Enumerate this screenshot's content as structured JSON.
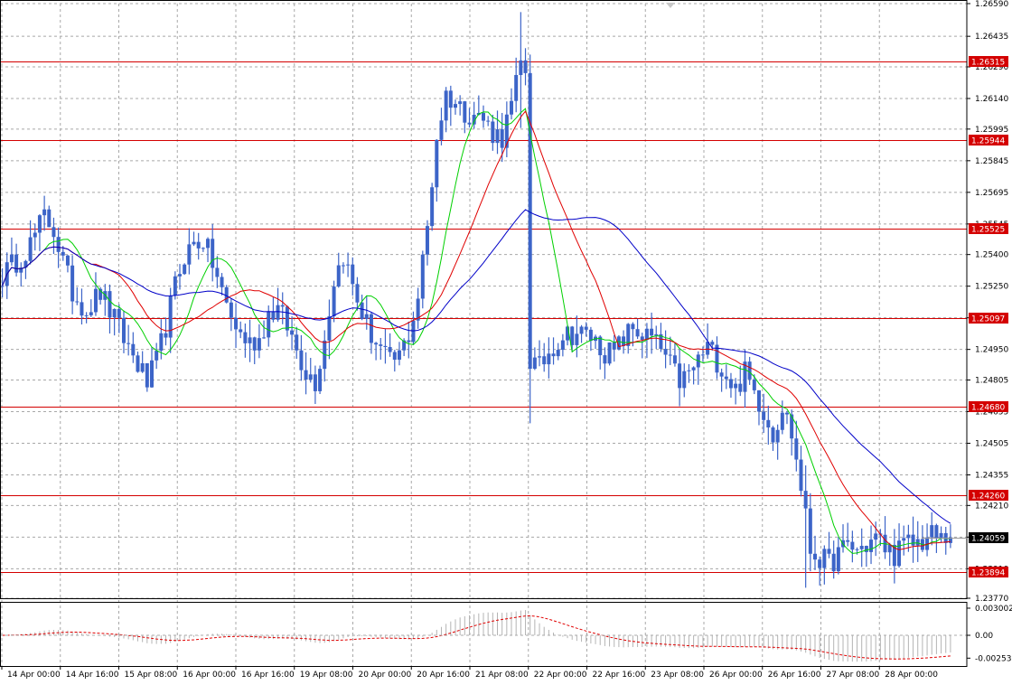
{
  "chart_data": {
    "type": "candlestick",
    "instrument_hint": "forex",
    "price_axis": {
      "min": 1.2377,
      "max": 1.2659,
      "ticks": [
        "1.26590",
        "1.26435",
        "1.26290",
        "1.26140",
        "1.25995",
        "1.25845",
        "1.25695",
        "1.25545",
        "1.25400",
        "1.25250",
        "1.25100",
        "1.24950",
        "1.24805",
        "1.24655",
        "1.24505",
        "1.24355",
        "1.24210",
        "1.24060",
        "1.23910",
        "1.23770"
      ]
    },
    "time_axis": {
      "labels": [
        "14 Apr 00:00",
        "14 Apr 16:00",
        "15 Apr 08:00",
        "16 Apr 00:00",
        "16 Apr 16:00",
        "19 Apr 08:00",
        "20 Apr 00:00",
        "20 Apr 16:00",
        "21 Apr 08:00",
        "22 Apr 00:00",
        "22 Apr 16:00",
        "23 Apr 08:00",
        "26 Apr 00:00",
        "26 Apr 16:00",
        "27 Apr 08:00",
        "28 Apr 00:00"
      ]
    },
    "horizontal_levels": [
      {
        "price": 1.26315,
        "label": "1.26315",
        "color": "#d40000"
      },
      {
        "price": 1.25944,
        "label": "1.25944",
        "color": "#d40000"
      },
      {
        "price": 1.25525,
        "label": "1.25525",
        "color": "#d40000"
      },
      {
        "price": 1.25097,
        "label": "1.25097",
        "color": "#d40000"
      },
      {
        "price": 1.2468,
        "label": "1.24680",
        "color": "#d40000"
      },
      {
        "price": 1.2426,
        "label": "1.24260",
        "color": "#d40000"
      },
      {
        "price": 1.23894,
        "label": "1.23894",
        "color": "#d40000"
      }
    ],
    "current_price": {
      "price": 1.24059,
      "label": "1.24059"
    },
    "price_path": [
      [
        0,
        1.253
      ],
      [
        3,
        1.2537
      ],
      [
        6,
        1.2545
      ],
      [
        9,
        1.2558
      ],
      [
        11,
        1.2552
      ],
      [
        13,
        1.2536
      ],
      [
        15,
        1.2522
      ],
      [
        18,
        1.2514
      ],
      [
        21,
        1.2522
      ],
      [
        24,
        1.2509
      ],
      [
        27,
        1.2496
      ],
      [
        29,
        1.2488
      ],
      [
        31,
        1.2479
      ],
      [
        33,
        1.2489
      ],
      [
        35,
        1.2506
      ],
      [
        37,
        1.2525
      ],
      [
        39,
        1.254
      ],
      [
        41,
        1.2545
      ],
      [
        43,
        1.2547
      ],
      [
        45,
        1.2536
      ],
      [
        47,
        1.2522
      ],
      [
        49,
        1.251
      ],
      [
        51,
        1.2502
      ],
      [
        53,
        1.2498
      ],
      [
        55,
        1.25
      ],
      [
        57,
        1.2512
      ],
      [
        59,
        1.2514
      ],
      [
        61,
        1.2506
      ],
      [
        63,
        1.2495
      ],
      [
        65,
        1.2485
      ],
      [
        67,
        1.248
      ],
      [
        69,
        1.25
      ],
      [
        71,
        1.2528
      ],
      [
        73,
        1.254
      ],
      [
        75,
        1.2525
      ],
      [
        77,
        1.2512
      ],
      [
        79,
        1.2502
      ],
      [
        81,
        1.2495
      ],
      [
        83,
        1.2488
      ],
      [
        85,
        1.2492
      ],
      [
        87,
        1.2502
      ],
      [
        89,
        1.252
      ],
      [
        91,
        1.2553
      ],
      [
        93,
        1.2596
      ],
      [
        95,
        1.2616
      ],
      [
        97,
        1.2612
      ],
      [
        99,
        1.2608
      ],
      [
        101,
        1.2607
      ],
      [
        103,
        1.2604
      ],
      [
        105,
        1.2598
      ],
      [
        107,
        1.2596
      ],
      [
        109,
        1.261
      ],
      [
        111,
        1.263
      ],
      [
        112,
        1.2628
      ],
      [
        113,
        1.249
      ],
      [
        115,
        1.2486
      ],
      [
        117,
        1.2494
      ],
      [
        120,
        1.2502
      ],
      [
        123,
        1.2503
      ],
      [
        126,
        1.2501
      ],
      [
        129,
        1.2494
      ],
      [
        131,
        1.2493
      ],
      [
        133,
        1.25
      ],
      [
        135,
        1.2505
      ],
      [
        137,
        1.2502
      ],
      [
        139,
        1.25
      ],
      [
        141,
        1.2495
      ],
      [
        143,
        1.2487
      ],
      [
        145,
        1.248
      ],
      [
        147,
        1.2483
      ],
      [
        149,
        1.249
      ],
      [
        151,
        1.2496
      ],
      [
        153,
        1.249
      ],
      [
        155,
        1.2483
      ],
      [
        157,
        1.2476
      ],
      [
        159,
        1.2484
      ],
      [
        161,
        1.2475
      ],
      [
        163,
        1.2466
      ],
      [
        165,
        1.2455
      ],
      [
        167,
        1.2468
      ],
      [
        169,
        1.2455
      ],
      [
        171,
        1.243
      ],
      [
        173,
        1.24
      ],
      [
        175,
        1.2396
      ],
      [
        177,
        1.2393
      ],
      [
        179,
        1.2398
      ],
      [
        181,
        1.2402
      ],
      [
        183,
        1.24
      ],
      [
        185,
        1.2402
      ],
      [
        187,
        1.2406
      ],
      [
        189,
        1.2401
      ],
      [
        191,
        1.2398
      ],
      [
        193,
        1.2402
      ],
      [
        195,
        1.2403
      ],
      [
        197,
        1.2404
      ],
      [
        199,
        1.2407
      ],
      [
        201,
        1.2405
      ],
      [
        203,
        1.24059
      ]
    ],
    "spikes": [
      {
        "i": 111,
        "high": 1.2655,
        "low": 1.26
      },
      {
        "i": 113,
        "high": 1.262,
        "low": 1.246
      },
      {
        "i": 172,
        "high": 1.244,
        "low": 1.2382
      },
      {
        "i": 145,
        "high": 1.2495,
        "low": 1.247
      }
    ],
    "moving_averages": [
      {
        "period": 5,
        "color": "#00d000"
      },
      {
        "period": 10,
        "color": "#e00000"
      },
      {
        "period": 20,
        "color": "#0000c8"
      }
    ],
    "oscillator": {
      "ticks": [
        "0.003002",
        "0.00",
        "-0.00253"
      ],
      "min": -0.0034,
      "max": 0.0036,
      "histogram_color": "#b4b4b4",
      "signal_color": "#e00000"
    },
    "colors": {
      "candle": "#3c64c8",
      "grid": "#a8a8a8",
      "current_price_box": "#000000",
      "level_box": "#d40000"
    }
  }
}
